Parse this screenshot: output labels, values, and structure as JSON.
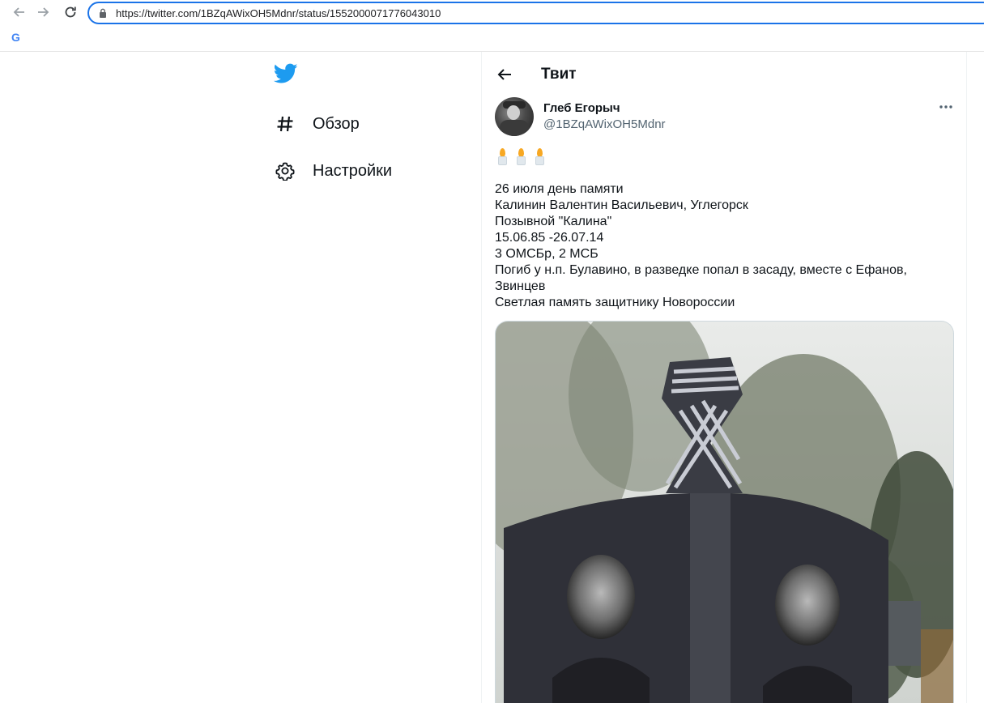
{
  "browser": {
    "url": "https://twitter.com/1BZqAWixOH5Mdnr/status/1552000071776043010",
    "bookmark_label": "G"
  },
  "sidebar": {
    "items": [
      {
        "icon": "hashtag-icon",
        "label": "Обзор"
      },
      {
        "icon": "gear-icon",
        "label": "Настройки"
      }
    ]
  },
  "header": {
    "title": "Твит"
  },
  "tweet": {
    "author_name": "Глеб Егорыч",
    "author_handle": "@1BZqAWixOH5Mdnr",
    "emoji": "🕯🕯🕯",
    "lines": [
      "26 июля день памяти",
      "Калинин Валентин Васильевич, Углегорск",
      "Позывной \"Калина\"",
      "15.06.85 -26.07.14",
      "3 ОМСБр, 2 МСБ",
      "Погиб у н.п. Булавино, в разведке попал в засаду, вместе с Ефанов,",
      "Звинцев",
      "Светлая память защитнику Новороссии"
    ]
  },
  "colors": {
    "accent": "#1d9bf0",
    "text": "#0f1419",
    "secondary": "#536471",
    "omnibox_focus": "#1a73e8"
  }
}
